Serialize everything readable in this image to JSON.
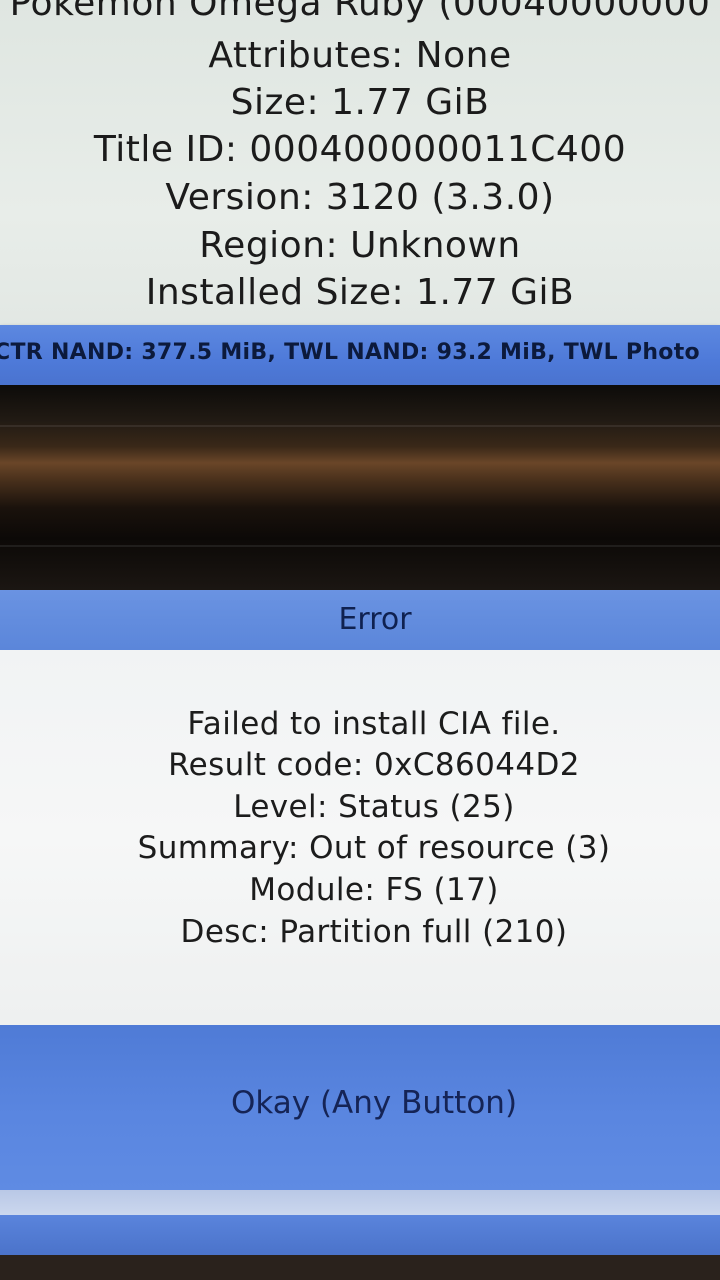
{
  "top_screen": {
    "info_lines": [
      "Pokemon Omega Ruby (00040000000",
      "Attributes: None",
      "Size: 1.77 GiB",
      "Title ID: 000400000011C400",
      "Version: 3120 (3.3.0)",
      "Region: Unknown",
      "Installed Size: 1.77 GiB"
    ],
    "status_bar": "CTR NAND: 377.5 MiB, TWL NAND: 93.2 MiB, TWL Photo"
  },
  "dialog": {
    "title": "Error",
    "message_lines": [
      "Failed to install CIA file.",
      "Result code: 0xC86044D2",
      "Level: Status (25)",
      "Summary: Out of resource (3)",
      "Module: FS (17)",
      "Desc: Partition full (210)"
    ],
    "button_label": "Okay (Any Button)"
  },
  "colors": {
    "accent_blue": "#5b86da",
    "panel_background": "#e3e9e5",
    "text_dark": "#1b1b1b"
  }
}
